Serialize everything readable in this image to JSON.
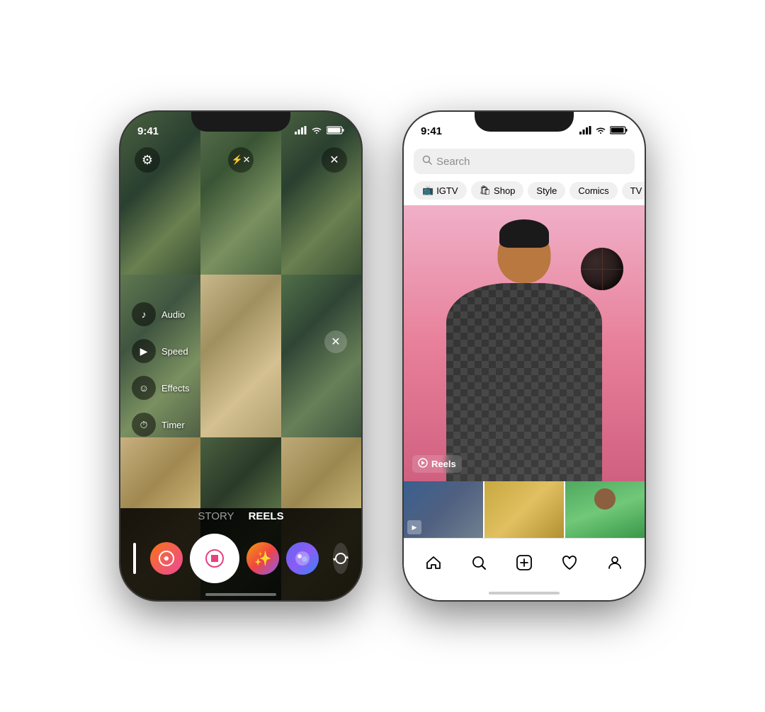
{
  "left_phone": {
    "status_time": "9:41",
    "camera_mode": {
      "story": "STORY",
      "reels": "REELS"
    },
    "side_menu": [
      {
        "icon": "♪",
        "label": "Audio"
      },
      {
        "icon": "▶",
        "label": "Speed"
      },
      {
        "icon": "☺",
        "label": "Effects"
      },
      {
        "icon": "⏱",
        "label": "Timer"
      }
    ]
  },
  "right_phone": {
    "status_time": "9:41",
    "search_placeholder": "Search",
    "filter_tabs": [
      {
        "icon": "📺",
        "label": "IGTV"
      },
      {
        "icon": "🛍",
        "label": "Shop"
      },
      {
        "icon": "",
        "label": "Style"
      },
      {
        "icon": "",
        "label": "Comics"
      },
      {
        "icon": "",
        "label": "TV & Movies"
      }
    ],
    "reels_label": "Reels",
    "nav_items": [
      {
        "icon": "⌂",
        "name": "home"
      },
      {
        "icon": "🔍",
        "name": "search"
      },
      {
        "icon": "⊕",
        "name": "add"
      },
      {
        "icon": "♡",
        "name": "likes"
      },
      {
        "icon": "◯",
        "name": "profile"
      }
    ]
  }
}
